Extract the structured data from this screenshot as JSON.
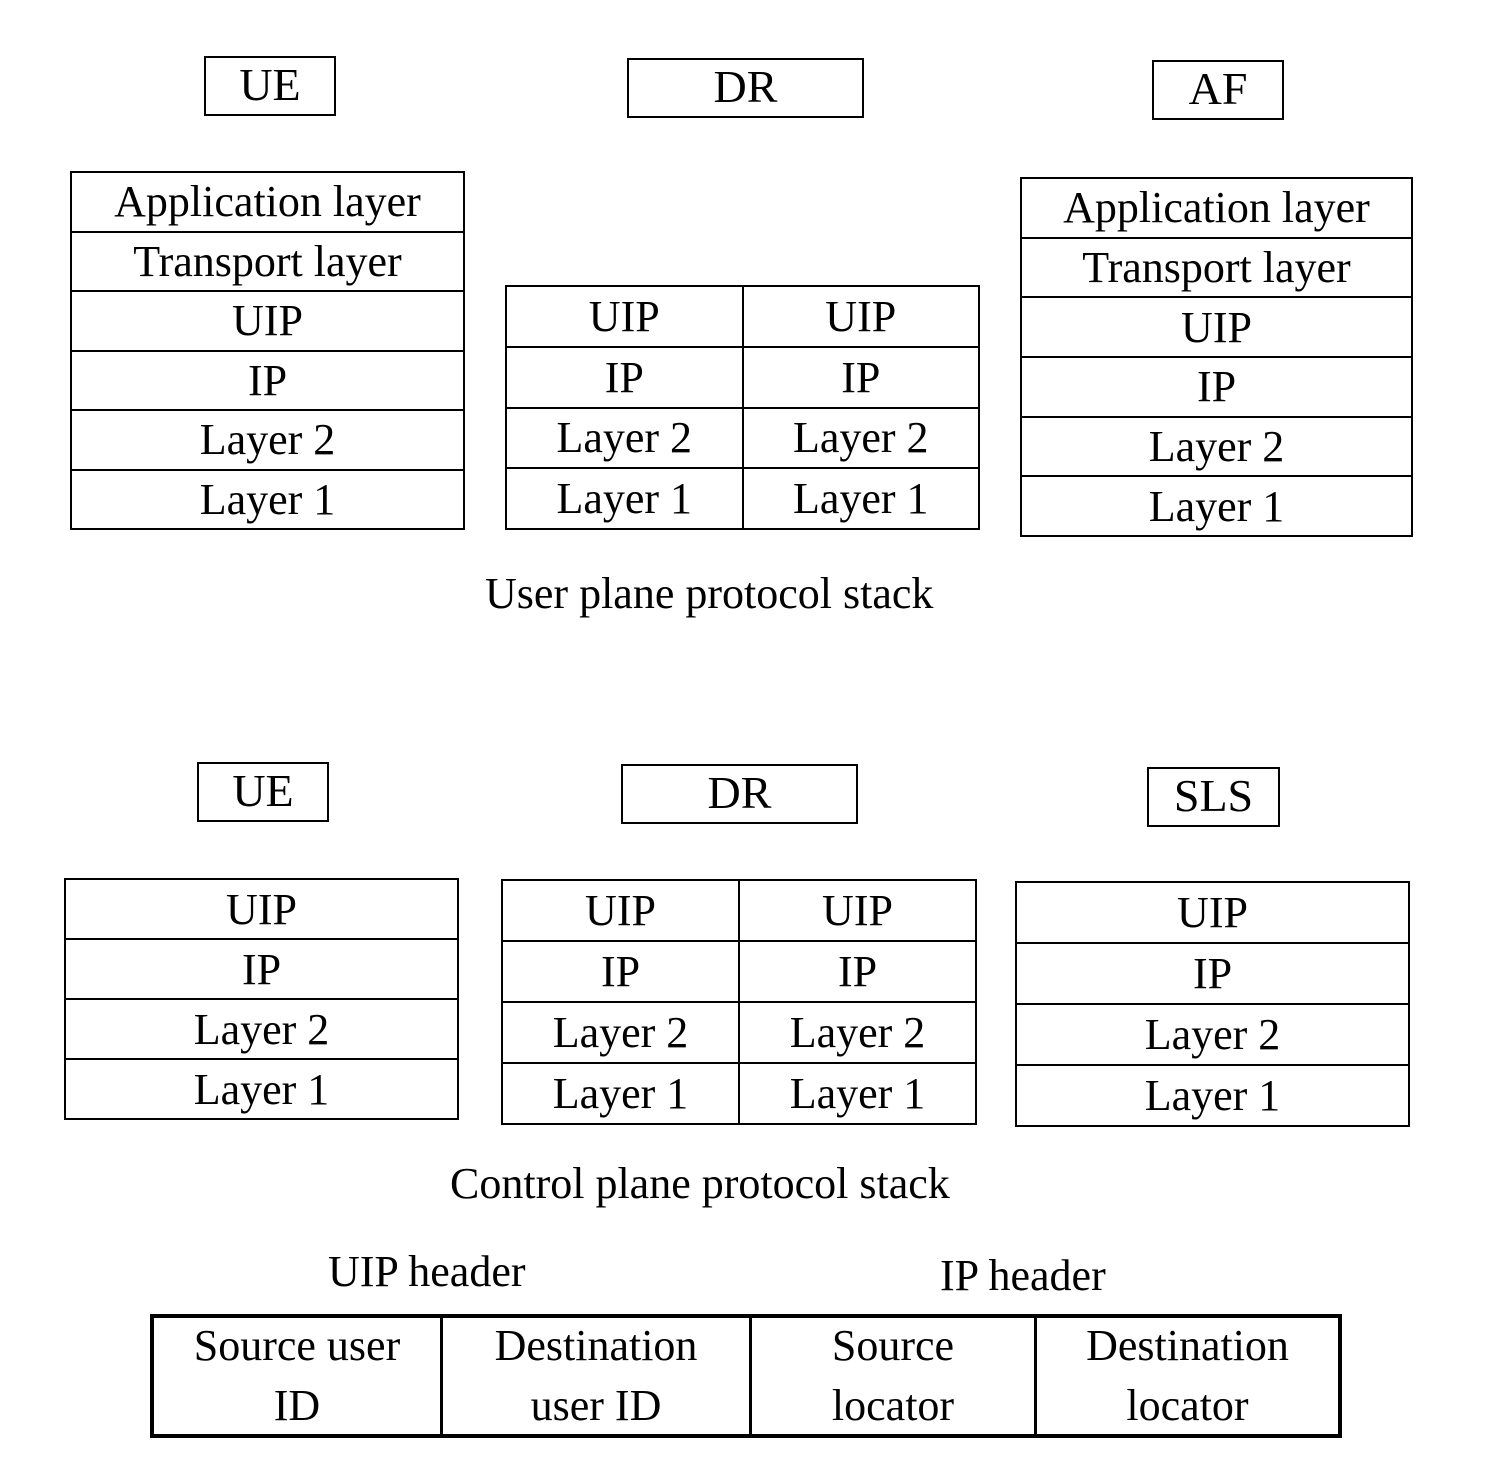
{
  "user_plane": {
    "caption": "User plane protocol stack",
    "nodes": [
      {
        "label": "UE",
        "columns": [
          [
            "Application layer",
            "Transport layer",
            "UIP",
            "IP",
            "Layer 2",
            "Layer 1"
          ]
        ]
      },
      {
        "label": "DR",
        "columns": [
          [
            "UIP",
            "IP",
            "Layer 2",
            "Layer 1"
          ],
          [
            "UIP",
            "IP",
            "Layer 2",
            "Layer 1"
          ]
        ]
      },
      {
        "label": "AF",
        "columns": [
          [
            "Application layer",
            "Transport layer",
            "UIP",
            "IP",
            "Layer 2",
            "Layer 1"
          ]
        ]
      }
    ]
  },
  "control_plane": {
    "caption": "Control plane protocol stack",
    "nodes": [
      {
        "label": "UE",
        "columns": [
          [
            "UIP",
            "IP",
            "Layer 2",
            "Layer 1"
          ]
        ]
      },
      {
        "label": "DR",
        "columns": [
          [
            "UIP",
            "IP",
            "Layer 2",
            "Layer 1"
          ],
          [
            "UIP",
            "IP",
            "Layer 2",
            "Layer 1"
          ]
        ]
      },
      {
        "label": "SLS",
        "columns": [
          [
            "UIP",
            "IP",
            "Layer 2",
            "Layer 1"
          ]
        ]
      }
    ]
  },
  "header_format": {
    "uip_header_label": "UIP header",
    "ip_header_label": "IP header",
    "fields": [
      {
        "line1": "Source user",
        "line2": "ID"
      },
      {
        "line1": "Destination",
        "line2": "user ID"
      },
      {
        "line1": "Source",
        "line2": "locator"
      },
      {
        "line1": "Destination",
        "line2": "locator"
      }
    ]
  }
}
